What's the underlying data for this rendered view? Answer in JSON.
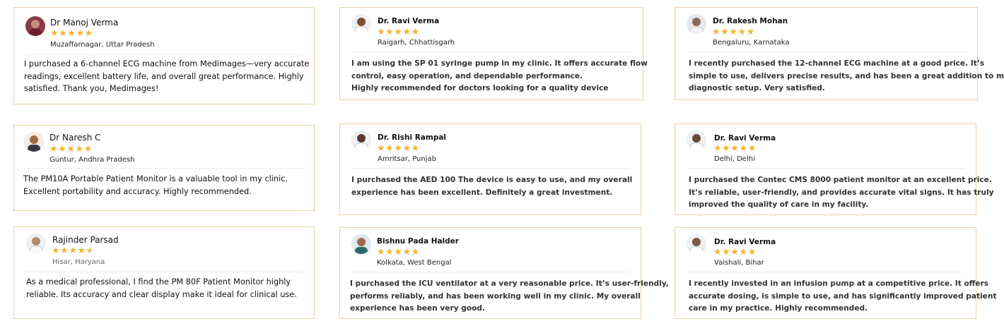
{
  "reviews": [
    {
      "name": "Dr Manoj Verma",
      "stars": "★★★★★",
      "location": "Muzaffarnagar, Uttar Pradesh",
      "lines": [
        "I purchased a 6-channel ECG machine from Medimages—very accurate",
        "readings, excellent battery life, and overall great performance. Highly",
        "satisfied. Thank you, Medimages!"
      ]
    },
    {
      "name": "Dr. Ravi Verma",
      "stars": "★★★★★",
      "location": "Raigarh, Chhattisgarh",
      "lines": [
        "I am using the SP 01 syringe pump in my clinic. It offers accurate flow",
        "control, easy operation, and dependable performance.",
        "Highly recommended for doctors looking for a quality device"
      ]
    },
    {
      "name": "Dr. Rakesh Mohan",
      "stars": "★★★★★",
      "location": "Bengaluru, Karnataka",
      "lines": [
        "I recently purchased the 12-channel ECG machine at a good price. It’s",
        "simple to use, delivers precise results, and has been a great addition to my",
        "diagnostic setup. Very satisfied."
      ]
    },
    {
      "name": "Dr Naresh C",
      "stars": "★★★★★",
      "location": "Guntur, Andhra Pradesh",
      "lines": [
        "The PM10A Portable Patient Monitor is a valuable tool in my clinic.",
        "Excellent portability and accuracy. Highly recommended."
      ]
    },
    {
      "name": "Dr. Rishi Rampal",
      "stars": "★★★★★",
      "location": "Amritsar, Punjab",
      "lines": [
        "I purchased the AED 100 The device is easy to use, and my overall",
        "experience has been excellent. Definitely a great investment."
      ]
    },
    {
      "name": "Dr. Ravi Verma",
      "stars": "★★★★★",
      "location": "Delhi, Delhi",
      "lines": [
        "I purchased the Contec CMS 8000 patient monitor at an excellent price.",
        "It’s reliable, user-friendly, and provides accurate vital signs. It has truly",
        "improved the quality of care in my facility."
      ]
    },
    {
      "name": "Rajinder Parsad",
      "stars": "★★★★",
      "rating": 4.5,
      "location": "Hisar, Haryana",
      "lines": [
        "As a medical professional, I find the PM 80F Patient Monitor highly",
        "reliable. Its accuracy and clear display make it ideal for clinical use."
      ]
    },
    {
      "name": "Bishnu Pada Halder",
      "stars": "★★★★★",
      "location": "Kolkata, West Bengal",
      "lines": [
        "I purchased the ICU ventilator at a very reasonable price. It’s user-friendly,",
        "performs reliably, and has been working well in my clinic. My overall",
        "experience has been very good."
      ]
    },
    {
      "name": "Dr. Ravi Verma",
      "stars": "★★★★★",
      "location": "Vaishali, Bihar",
      "lines": [
        "I recently invested in an infusion pump at a competitive price. It offers",
        "accurate dosing, is simple to use, and has significantly improved patient",
        "care in my practice. Highly recommended."
      ]
    }
  ],
  "colors": {
    "star": "#f2b42c",
    "border": "#e8d3a6",
    "text": "#111111"
  },
  "icons": {
    "avatar": "avatar-photo",
    "star": "star-icon"
  }
}
